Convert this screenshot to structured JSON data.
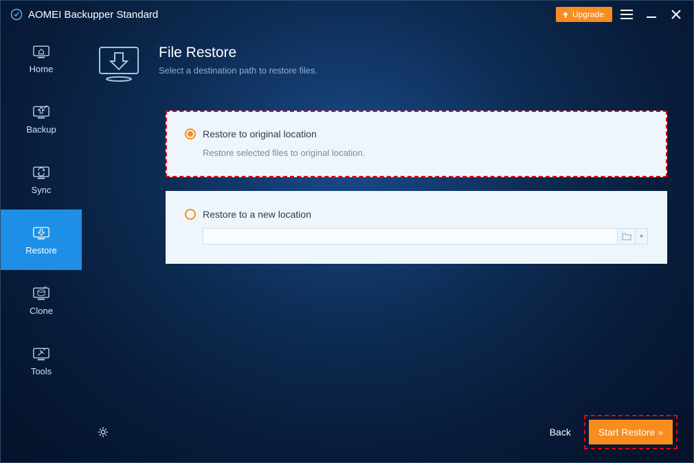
{
  "titlebar": {
    "app_name": "AOMEI Backupper Standard",
    "upgrade_label": "Upgrade"
  },
  "sidebar": {
    "items": [
      {
        "label": "Home"
      },
      {
        "label": "Backup"
      },
      {
        "label": "Sync"
      },
      {
        "label": "Restore"
      },
      {
        "label": "Clone"
      },
      {
        "label": "Tools"
      }
    ]
  },
  "header": {
    "title": "File Restore",
    "subtitle": "Select a destination path to restore files."
  },
  "options": {
    "original": {
      "label": "Restore to original location",
      "desc": "Restore selected files to original location."
    },
    "new": {
      "label": "Restore to a new location",
      "path": ""
    }
  },
  "footer": {
    "back_label": "Back",
    "start_label": "Start Restore »"
  }
}
